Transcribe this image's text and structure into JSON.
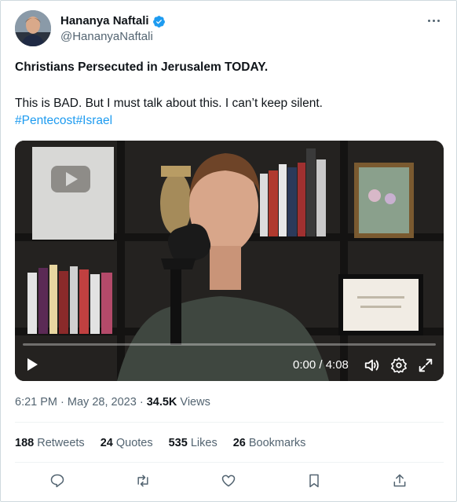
{
  "author": {
    "display_name": "Hananya Naftali",
    "handle": "@HananyaNaftali"
  },
  "tweet": {
    "title": "Christians Persecuted in Jerusalem TODAY.",
    "body": "This is BAD. But I must talk about this. I can’t keep silent.",
    "hashtags": [
      "#Pentecost",
      "#Israel"
    ]
  },
  "video": {
    "time": "0:00 / 4:08",
    "progress": 0.0
  },
  "meta": {
    "time": "6:21 PM",
    "separator": "·",
    "date": "May 28, 2023",
    "views_count": "34.5K",
    "views_label": "Views"
  },
  "stats": {
    "retweets_count": "188",
    "retweets_label": "Retweets",
    "quotes_count": "24",
    "quotes_label": "Quotes",
    "likes_count": "535",
    "likes_label": "Likes",
    "bookmarks_count": "26",
    "bookmarks_label": "Bookmarks"
  },
  "icons": {
    "verified": "verified-badge-icon",
    "more": "more-options-icon",
    "reply": "reply-icon",
    "retweet": "retweet-icon",
    "like": "heart-icon",
    "bookmark": "bookmark-icon",
    "share": "share-icon",
    "play": "play-icon",
    "volume": "volume-icon",
    "settings": "gear-icon",
    "fullscreen": "fullscreen-icon"
  },
  "colors": {
    "accent": "#1d9bf0",
    "text": "#0f1419",
    "secondary": "#536471"
  }
}
